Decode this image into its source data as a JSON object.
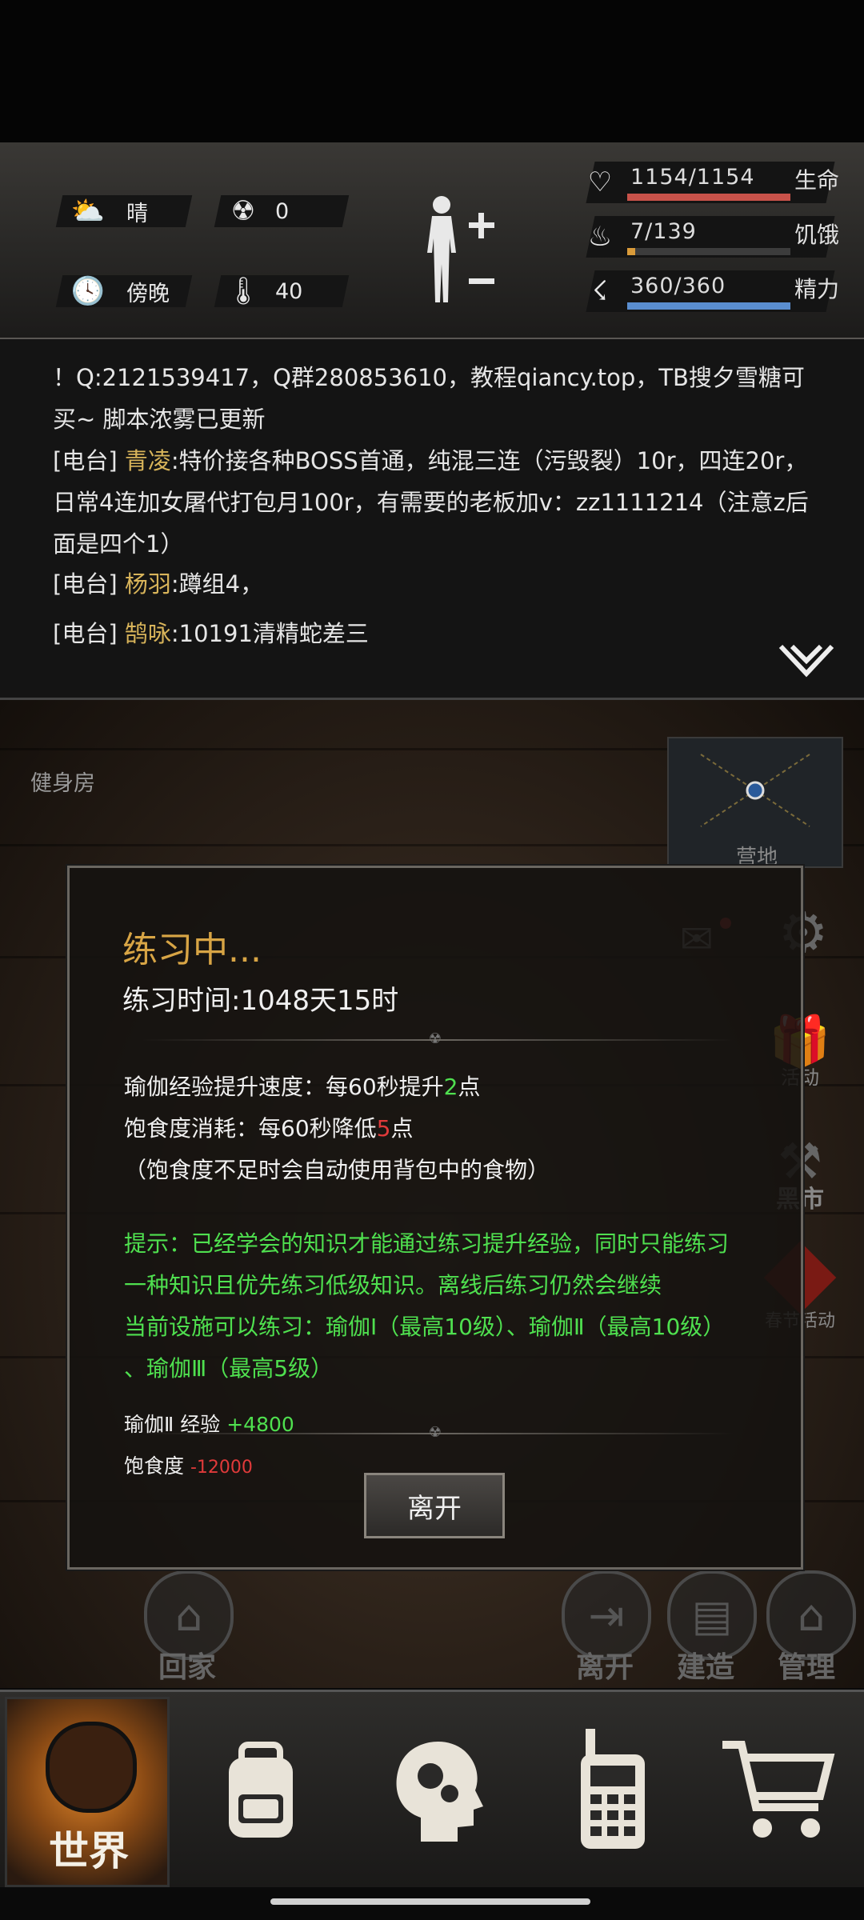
{
  "hud": {
    "weather": "晴",
    "radiation": "0",
    "time_of_day": "傍晚",
    "temperature": "40",
    "stats": [
      {
        "value": "1154/1154",
        "label": "生命",
        "fill": 1.0,
        "color": "#c8524a",
        "icon": "heart-icon"
      },
      {
        "value": "7/139",
        "label": "饥饿",
        "fill": 0.05,
        "color": "#d99b3a",
        "icon": "stomach-icon"
      },
      {
        "value": "360/360",
        "label": "精力",
        "fill": 1.0,
        "color": "#5a8ed0",
        "icon": "energy-icon"
      }
    ]
  },
  "chat": {
    "lines": [
      {
        "text": "！Q:2121539417，Q群280853610，教程qiancy.top，TB搜夕雪糖可买~ 脚本浓雾已更新"
      },
      {
        "tag": "[电台]",
        "name": "青凌",
        "text": ":特价接各种BOSS首通，纯混三连（污毁裂）10r，四连20r，日常4连加女屠代打包月100r，有需要的老板加v：zz1111214（注意z后面是四个1）"
      },
      {
        "tag": "[电台]",
        "name": "杨羽",
        "text": ":蹲组4，"
      },
      {
        "tag": "[电台]",
        "name": "鹄咏",
        "text": ":10191清精蛇差三"
      }
    ]
  },
  "scene": {
    "location": "健身房",
    "minimap_label": "营地"
  },
  "modal": {
    "title": "练习中...",
    "duration": "练习时间:1048天15时",
    "yoga_speed_prefix": "瑜伽经验提升速度：每60秒提升",
    "yoga_speed_value": "2",
    "yoga_speed_suffix": "点",
    "hunger_prefix": "饱食度消耗：每60秒降低",
    "hunger_value": "5",
    "hunger_suffix": "点",
    "hunger_note": "（饱食度不足时会自动使用背包中的食物）",
    "tip_lines": [
      "提示：已经学会的知识才能通过练习提升经验，同时只能练习",
      "一种知识且优先练习低级知识。离线后练习仍然会继续",
      "当前设施可以练习：瑜伽Ⅰ（最高10级）、瑜伽Ⅱ（最高10级）",
      "、瑜伽Ⅲ（最高5级）"
    ],
    "exp_label": "瑜伽Ⅱ 经验",
    "exp_value": "+4800",
    "satiety_label": "饱食度",
    "satiety_value": "-12000",
    "leave_button": "离开"
  },
  "side": {
    "activity": "活动",
    "market": "黑市",
    "spring": "春节活动"
  },
  "actions": {
    "home": "回家",
    "leave": "离开",
    "build": "建造",
    "manage": "管理"
  },
  "nav": {
    "world": "世界"
  }
}
